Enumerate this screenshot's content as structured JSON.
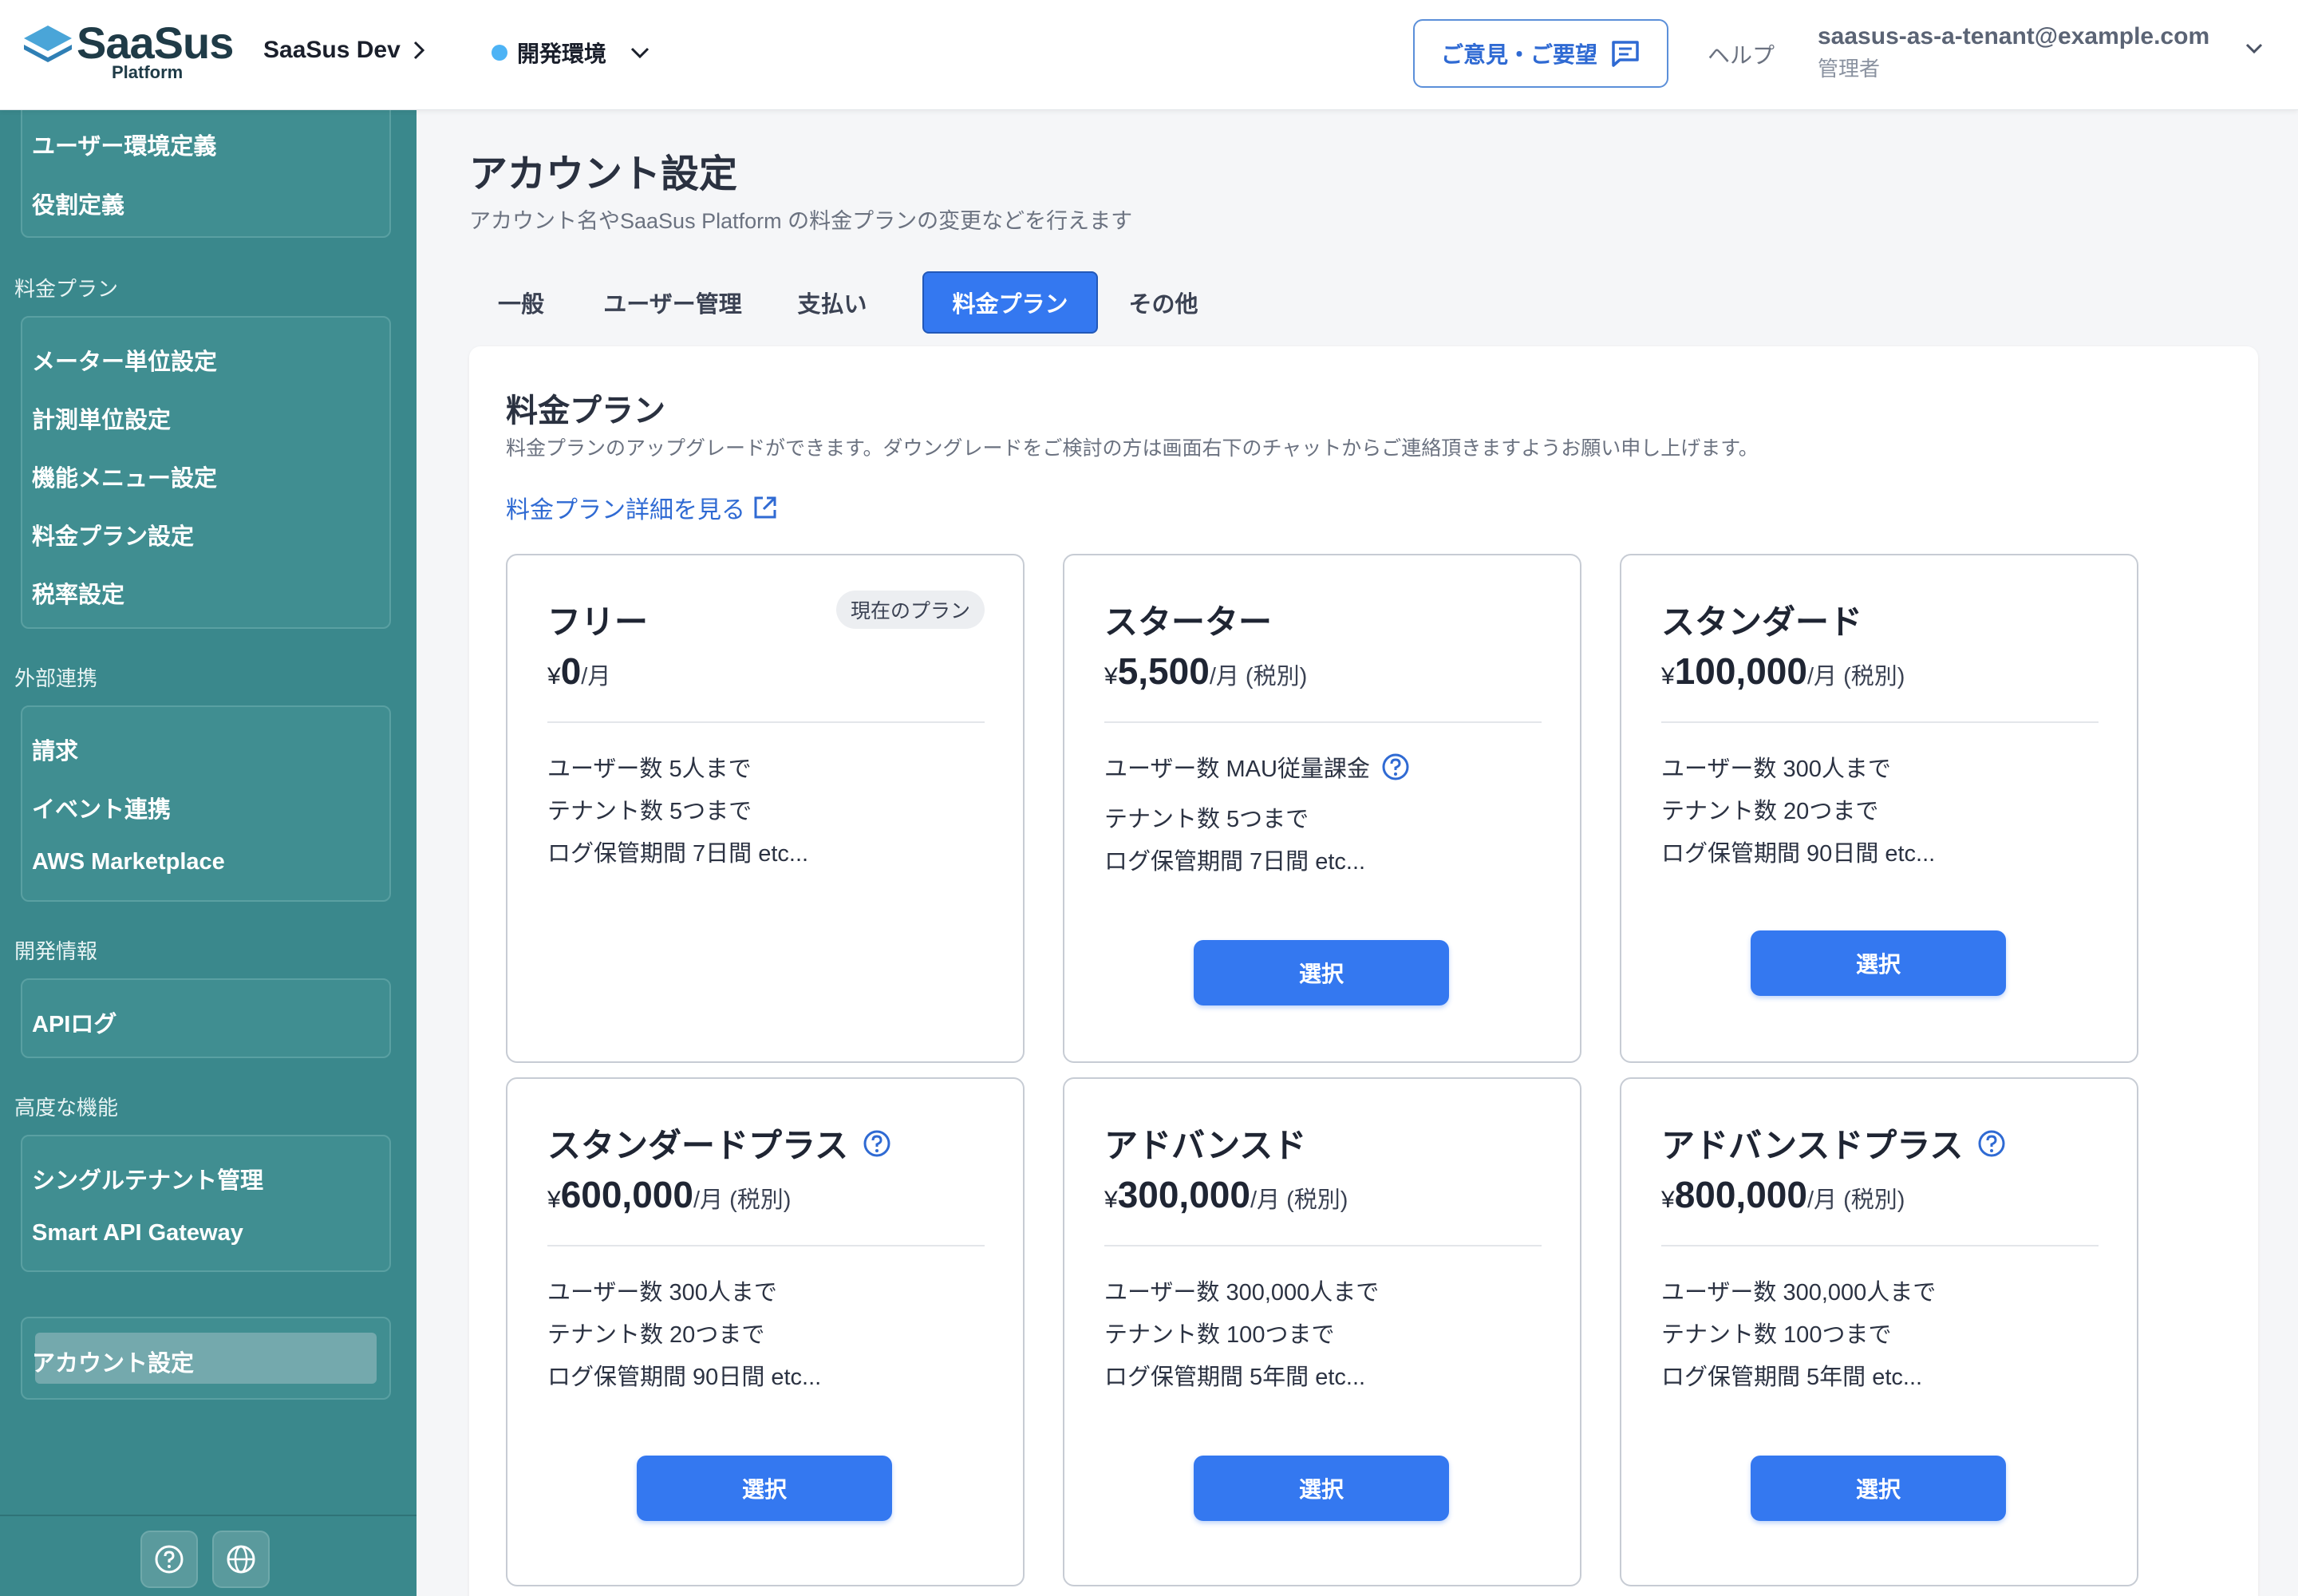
{
  "header": {
    "logo_text": "SaaSus",
    "logo_sub": "Platform",
    "project_name": "SaaSus Dev",
    "environment": "開発環境",
    "feedback_label": "ご意見・ご要望",
    "help_label": "ヘルプ",
    "user_email": "saasus-as-a-tenant@example.com",
    "user_role": "管理者"
  },
  "sidebar": {
    "group0": [
      "ユーザー環境定義",
      "役割定義"
    ],
    "section_pricing": "料金プラン",
    "group_pricing": [
      "メーター単位設定",
      "計測単位設定",
      "機能メニュー設定",
      "料金プラン設定",
      "税率設定"
    ],
    "section_external": "外部連携",
    "group_external": [
      "請求",
      "イベント連携",
      "AWS Marketplace"
    ],
    "section_dev": "開発情報",
    "group_dev": [
      "APIログ"
    ],
    "section_advanced": "高度な機能",
    "group_advanced": [
      "シングルテナント管理",
      "Smart API Gateway"
    ],
    "account": "アカウント設定"
  },
  "main": {
    "title": "アカウント設定",
    "description": "アカウント名やSaaSus Platform の料金プランの変更などを行えます",
    "tabs": [
      "一般",
      "ユーザー管理",
      "支払い",
      "料金プラン",
      "その他"
    ],
    "active_tab": "料金プラン",
    "panel_title": "料金プラン",
    "panel_desc": "料金プランのアップグレードができます。ダウングレードをご検討の方は画面右下のチャットからご連絡頂きますようお願い申し上げます。",
    "plan_link": "料金プラン詳細を見る"
  },
  "plans": [
    {
      "name": "フリー",
      "yen": "¥",
      "amount": "0",
      "unit": "/月",
      "badge": "現在のプラン",
      "features": [
        "ユーザー数 5人まで",
        "テナント数 5つまで",
        "ログ保管期間 7日間 etc..."
      ]
    },
    {
      "name": "スターター",
      "yen": "¥",
      "amount": "5,500",
      "unit": "/月 (税別)",
      "features": [
        "ユーザー数 MAU従量課金",
        "テナント数 5つまで",
        "ログ保管期間 7日間 etc..."
      ],
      "button": "選択"
    },
    {
      "name": "スタンダード",
      "yen": "¥",
      "amount": "100,000",
      "unit": "/月 (税別)",
      "features": [
        "ユーザー数 300人まで",
        "テナント数 20つまで",
        "ログ保管期間 90日間 etc..."
      ],
      "button": "選択"
    },
    {
      "name": "スタンダードプラス",
      "yen": "¥",
      "amount": "600,000",
      "unit": "/月 (税別)",
      "features": [
        "ユーザー数 300人まで",
        "テナント数 20つまで",
        "ログ保管期間 90日間 etc..."
      ],
      "button": "選択"
    },
    {
      "name": "アドバンスド",
      "yen": "¥",
      "amount": "300,000",
      "unit": "/月 (税別)",
      "features": [
        "ユーザー数 300,000人まで",
        "テナント数 100つまで",
        "ログ保管期間 5年間 etc..."
      ],
      "button": "選択"
    },
    {
      "name": "アドバンスドプラス",
      "yen": "¥",
      "amount": "800,000",
      "unit": "/月 (税別)",
      "features": [
        "ユーザー数 300,000人まで",
        "テナント数 100つまで",
        "ログ保管期間 5年間 etc..."
      ],
      "button": "選択"
    }
  ],
  "colors": {
    "sidebar_bg": "#3a888c",
    "accent": "#3478f0",
    "link": "#2f6ad3"
  }
}
